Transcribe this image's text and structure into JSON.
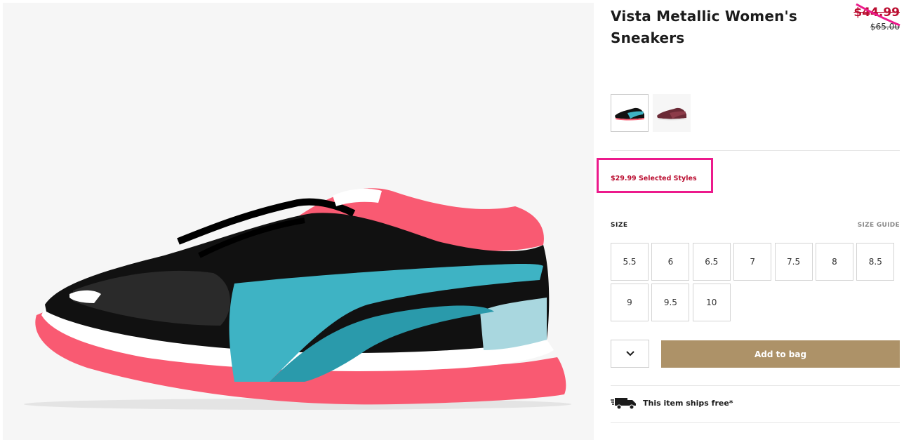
{
  "product": {
    "title": "Vista Metallic Women's Sneakers",
    "sale_price": "$44.99",
    "original_price": "$65.00",
    "image_icon": "sneaker-black-teal-pink"
  },
  "swatches": [
    {
      "name": "black-teal-pink",
      "selected": true
    },
    {
      "name": "burgundy",
      "selected": false
    }
  ],
  "promo": {
    "text": "$29.99 Selected Styles",
    "highlight_color": "#ec1a8c"
  },
  "size": {
    "label": "SIZE",
    "guide_label": "SIZE GUIDE",
    "options": [
      "5.5",
      "6",
      "6.5",
      "7",
      "7.5",
      "8",
      "8.5",
      "9",
      "9.5",
      "10"
    ]
  },
  "cart": {
    "quantity_icon": "chevron-down-icon",
    "add_label": "Add to bag",
    "button_color": "#ad9268"
  },
  "shipping": {
    "icon": "truck-icon",
    "text": "This item ships free*"
  },
  "colors": {
    "sale": "#ba0c2f",
    "annotation": "#ec1a8c"
  }
}
